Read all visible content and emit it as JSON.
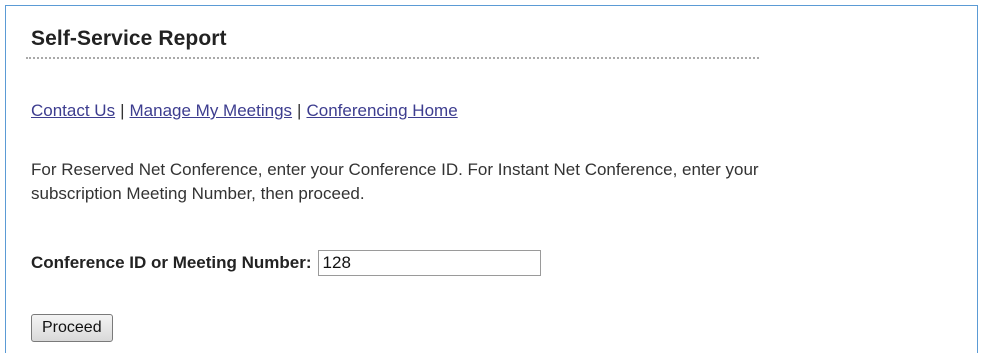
{
  "page": {
    "title": "Self-Service Report"
  },
  "nav": {
    "links": [
      {
        "label": "Contact Us"
      },
      {
        "label": "Manage My Meetings"
      },
      {
        "label": "Conferencing Home"
      }
    ],
    "separator": "|"
  },
  "instructions": {
    "line1": "For Reserved Net Conference, enter your Conference ID. For Instant Net Conference, enter your",
    "line2": "subscription Meeting Number, then proceed."
  },
  "form": {
    "conference_label": "Conference ID or Meeting Number:",
    "conference_value": "128",
    "proceed_label": "Proceed"
  },
  "colors": {
    "frame_border": "#5b9bd5",
    "link": "#3d3d8f"
  }
}
